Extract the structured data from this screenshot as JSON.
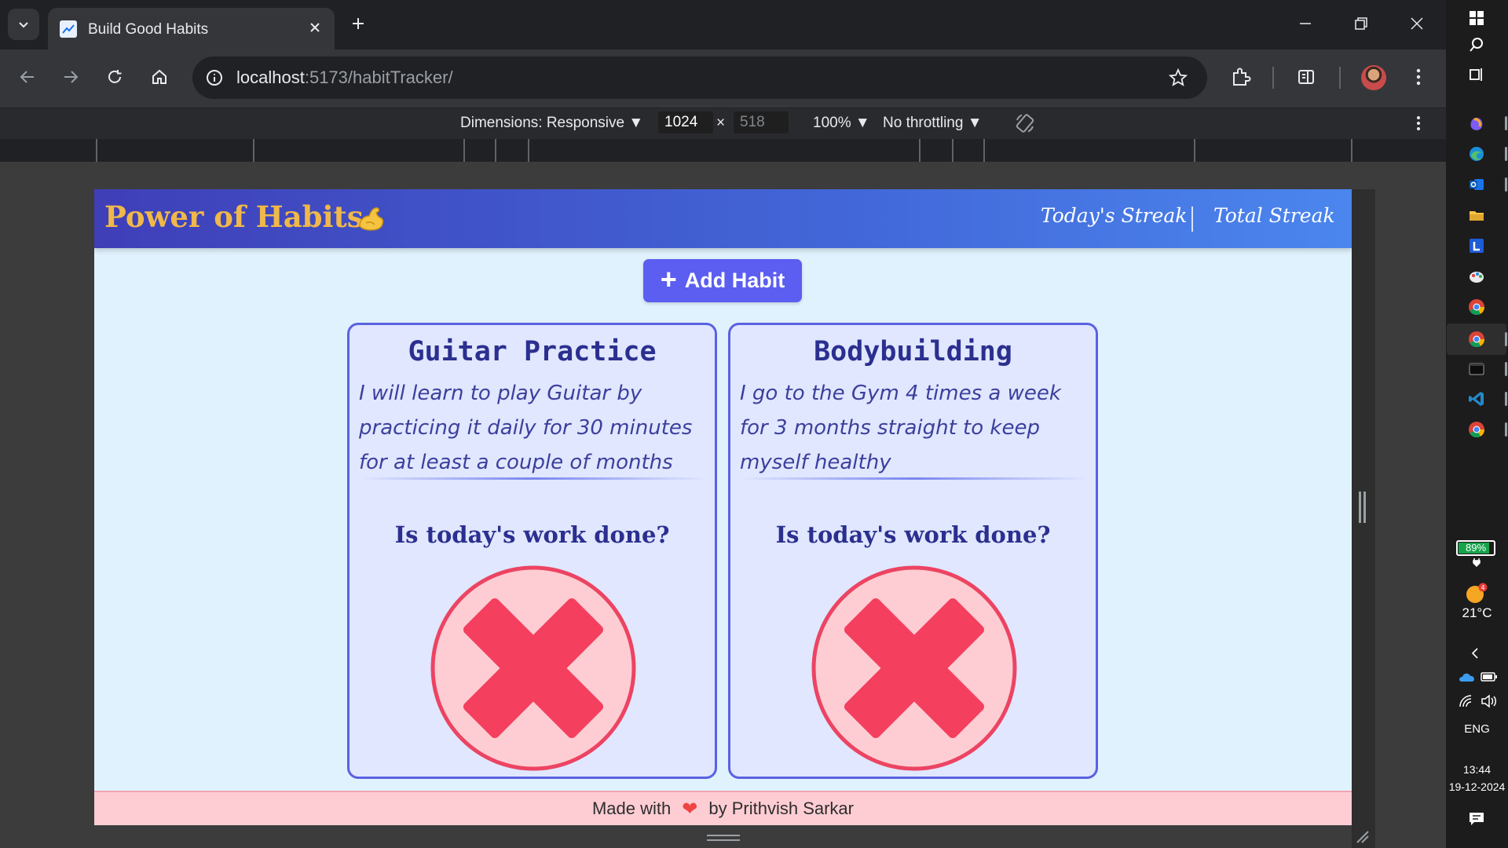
{
  "browser": {
    "tab_title": "Build Good Habits",
    "url_host": "localhost",
    "url_rest": ":5173/habitTracker/"
  },
  "devtools": {
    "dimensions_label": "Dimensions: Responsive ▼",
    "width_value": "1024",
    "height_value": "518",
    "times": "×",
    "zoom": "100% ▼",
    "throttle": "No throttling ▼"
  },
  "header": {
    "brand": "Power of Habits",
    "todays_streak": "Today's Streak",
    "total_streak": "Total Streak"
  },
  "actions": {
    "add_plus": "+",
    "add_habit": "Add Habit"
  },
  "habits": [
    {
      "title": "Guitar Practice",
      "description": "I will learn to play Guitar by practicing it daily for 30 minutes for at least a couple of months",
      "question": "Is today's work done?",
      "done": false
    },
    {
      "title": "Bodybuilding",
      "description": "I go to the Gym 4 times a week for 3 months straight to keep myself healthy",
      "question": "Is today's work done?",
      "done": false
    }
  ],
  "footer": {
    "made_with": "Made with",
    "heart": "❤",
    "by": "by Prithvish Sarkar"
  },
  "taskbar": {
    "battery": "89%",
    "battery_level": 0.89,
    "temperature": "21°C",
    "language": "ENG",
    "time": "13:44",
    "date": "19-12-2024"
  },
  "colors": {
    "header_start": "#3f3fb8",
    "header_end": "#4b86ee",
    "brand": "#f0b84a",
    "accent": "#5b5ef0",
    "cross": "#f43f5e",
    "page_bg": "#e0f2fe"
  }
}
